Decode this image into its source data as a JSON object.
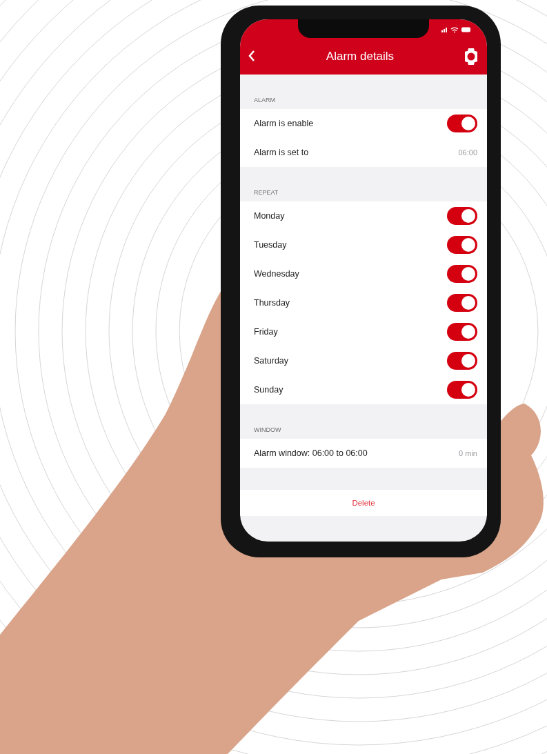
{
  "header": {
    "title": "Alarm details"
  },
  "sections": [
    {
      "title": "ALARM",
      "rows": [
        {
          "kind": "toggle",
          "label": "Alarm is enable",
          "on": true
        },
        {
          "kind": "value",
          "label": "Alarm is set to",
          "value": "06:00"
        }
      ]
    },
    {
      "title": "REPEAT",
      "rows": [
        {
          "kind": "toggle",
          "label": "Monday",
          "on": true
        },
        {
          "kind": "toggle",
          "label": "Tuesday",
          "on": true
        },
        {
          "kind": "toggle",
          "label": "Wednesday",
          "on": true
        },
        {
          "kind": "toggle",
          "label": "Thursday",
          "on": true
        },
        {
          "kind": "toggle",
          "label": "Friday",
          "on": true
        },
        {
          "kind": "toggle",
          "label": "Saturday",
          "on": true
        },
        {
          "kind": "toggle",
          "label": "Sunday",
          "on": true
        }
      ]
    },
    {
      "title": "WINDOW",
      "rows": [
        {
          "kind": "value",
          "label": "Alarm window: 06:00 to 06:00",
          "value": "0 min"
        }
      ]
    }
  ],
  "delete_button": {
    "label": "Delete"
  }
}
